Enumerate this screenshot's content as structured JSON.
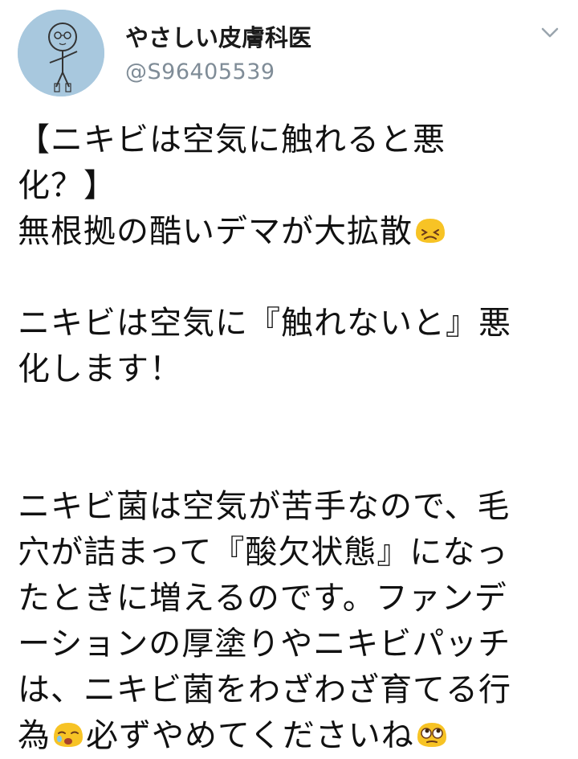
{
  "profile": {
    "display_name": "やさしい皮膚科医",
    "handle": "@S96405539",
    "avatar_color": "#a8c8de"
  },
  "header": {
    "menu_icon": "chevron-down-icon"
  },
  "tweet": {
    "lines": [
      {
        "text": "【ニキビは空気に触れると悪"
      },
      {
        "text": "化？】"
      },
      {
        "text": "無根拠の酷いデマが大拡散",
        "emoji": "frowning-face-icon"
      },
      {
        "text": ""
      },
      {
        "text": "ニキビは空気に『触れないと』悪"
      },
      {
        "text": "化します！"
      },
      {
        "text": ""
      },
      {
        "text": ""
      },
      {
        "text": "ニキビ菌は空気が苦手なので、毛"
      },
      {
        "text": "穴が詰まって『酸欠状態』になっ"
      },
      {
        "text": "たときに増えるのです。ファンデ"
      },
      {
        "text": "ーションの厚塗りやニキビパッチ"
      },
      {
        "text": "は、ニキビ菌をわざわざ育てる行"
      },
      {
        "text": "為",
        "emoji_mid": "crying-face-icon",
        "text2": "必ずやめてくださいね",
        "emoji": "rolling-eyes-face-icon"
      }
    ]
  },
  "colors": {
    "text": "#111111",
    "handle": "#7f8c97",
    "emoji_yellow": "#f7c325"
  }
}
